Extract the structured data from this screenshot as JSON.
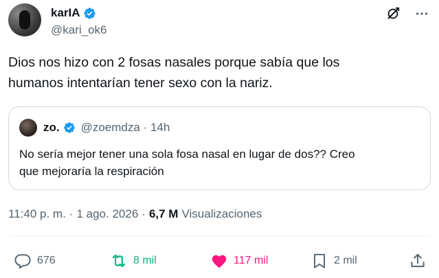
{
  "author": {
    "display_name": "karIA",
    "handle": "@kari_ok6"
  },
  "tweet": {
    "text_line1": "Dios nos hizo con 2 fosas nasales porque sabía que los",
    "text_line2": "humanos intentarían tener sexo con la nariz."
  },
  "quoted": {
    "display_name": "zo.",
    "handle": "@zoemdza · 14h",
    "text_line1": "No sería mejor tener una sola fosa nasal en lugar de dos?? Creo",
    "text_line2": "que mejoraría la respiración"
  },
  "meta": {
    "time": "11:40 p. m.",
    "sep1": "·",
    "date": "1 ago. 2026",
    "sep2": "·",
    "views_count": "6,7 M",
    "views_label": "Visualizaciones"
  },
  "actions": {
    "replies": "676",
    "reposts": "8 mil",
    "likes": "117 mil",
    "bookmarks": "2 mil"
  },
  "colors": {
    "verified": "#1d9bf0",
    "repost_active": "#00ba7c",
    "like_active": "#f91880",
    "secondary_text": "#536471"
  }
}
